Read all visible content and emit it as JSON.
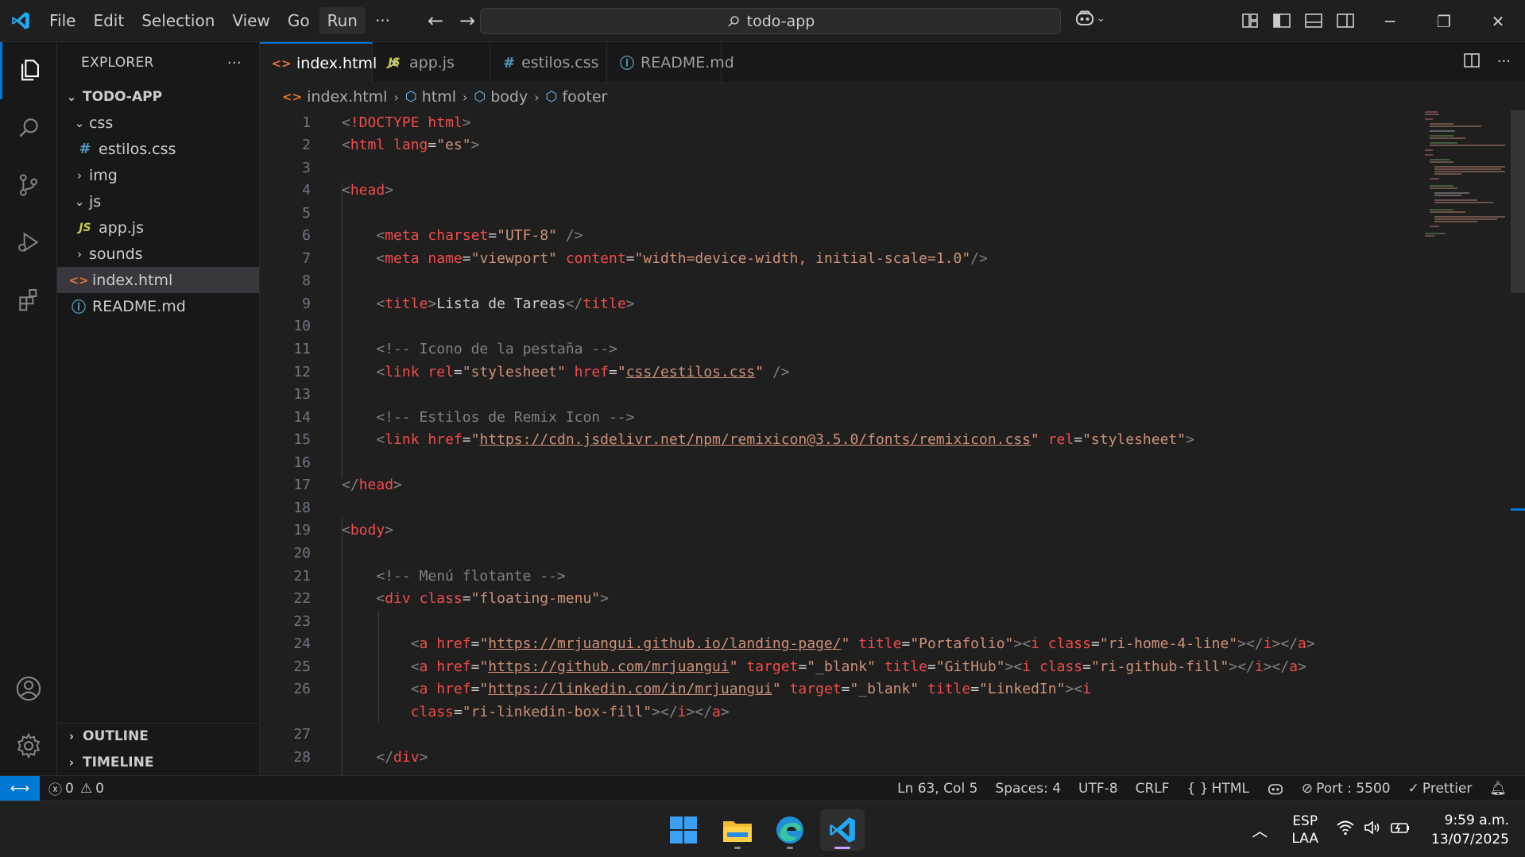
{
  "titlebar": {
    "menu": [
      "File",
      "Edit",
      "Selection",
      "View",
      "Go",
      "Run"
    ],
    "more": "···",
    "search_text": "todo-app"
  },
  "explorer": {
    "title": "EXPLORER",
    "more": "···",
    "project": "TODO-APP",
    "tree": [
      {
        "label": "css",
        "kind": "folder",
        "expanded": true,
        "depth": 1
      },
      {
        "label": "estilos.css",
        "kind": "css",
        "depth": 2
      },
      {
        "label": "img",
        "kind": "folder",
        "expanded": false,
        "depth": 1
      },
      {
        "label": "js",
        "kind": "folder",
        "expanded": true,
        "depth": 1
      },
      {
        "label": "app.js",
        "kind": "js",
        "depth": 2
      },
      {
        "label": "sounds",
        "kind": "folder",
        "expanded": false,
        "depth": 1
      },
      {
        "label": "index.html",
        "kind": "html",
        "depth": 1,
        "selected": true
      },
      {
        "label": "README.md",
        "kind": "info",
        "depth": 1
      }
    ],
    "outline": "OUTLINE",
    "timeline": "TIMELINE"
  },
  "tabs": [
    {
      "label": "index.html",
      "kind": "html",
      "active": true
    },
    {
      "label": "app.js",
      "kind": "js"
    },
    {
      "label": "estilos.css",
      "kind": "css"
    },
    {
      "label": "README.md",
      "kind": "info"
    }
  ],
  "breadcrumb": [
    "index.html",
    "html",
    "body",
    "footer"
  ],
  "code_lines": [
    {
      "n": "1",
      "html": "<span class='punc'>&lt;</span><span class='tag'>!DOCTYPE</span> <span class='attr'>html</span><span class='punc'>&gt;</span>"
    },
    {
      "n": "2",
      "html": "<span class='punc'>&lt;</span><span class='tag'>html</span> <span class='attr'>lang</span><span class='txt'>=</span><span class='str'>\"es\"</span><span class='punc'>&gt;</span>"
    },
    {
      "n": "3",
      "html": ""
    },
    {
      "n": "4",
      "html": "<span class='punc'>&lt;</span><span class='tag'>head</span><span class='punc'>&gt;</span>"
    },
    {
      "n": "5",
      "html": ""
    },
    {
      "n": "6",
      "html": "    <span class='punc'>&lt;</span><span class='tag'>meta</span> <span class='attr'>charset</span><span class='txt'>=</span><span class='str'>\"UTF-8\"</span> <span class='punc'>/&gt;</span>"
    },
    {
      "n": "7",
      "html": "    <span class='punc'>&lt;</span><span class='tag'>meta</span> <span class='attr'>name</span><span class='txt'>=</span><span class='str'>\"viewport\"</span> <span class='attr'>content</span><span class='txt'>=</span><span class='str'>\"width=device-width, initial-scale=1.0\"</span><span class='punc'>/&gt;</span>"
    },
    {
      "n": "8",
      "html": ""
    },
    {
      "n": "9",
      "html": "    <span class='punc'>&lt;</span><span class='tag'>title</span><span class='punc'>&gt;</span><span class='txt'>Lista de Tareas</span><span class='punc'>&lt;/</span><span class='tag'>title</span><span class='punc'>&gt;</span>"
    },
    {
      "n": "10",
      "html": ""
    },
    {
      "n": "11",
      "html": "    <span class='punc'>&lt;!-- Icono de la pestaña --&gt;</span>"
    },
    {
      "n": "12",
      "html": "    <span class='punc'>&lt;</span><span class='tag'>link</span> <span class='attr'>rel</span><span class='txt'>=</span><span class='str'>\"stylesheet\"</span> <span class='attr'>href</span><span class='txt'>=</span><span class='str'>\"<span class='link'>css/estilos.css</span>\"</span> <span class='punc'>/&gt;</span>"
    },
    {
      "n": "13",
      "html": ""
    },
    {
      "n": "14",
      "html": "    <span class='punc'>&lt;!-- Estilos de Remix Icon --&gt;</span>"
    },
    {
      "n": "15",
      "html": "    <span class='punc'>&lt;</span><span class='tag'>link</span> <span class='attr'>href</span><span class='txt'>=</span><span class='str'>\"<span class='link'>https://cdn.jsdelivr.net/npm/remixicon@3.5.0/fonts/remixicon.css</span>\"</span> <span class='attr'>rel</span><span class='txt'>=</span><span class='str'>\"stylesheet\"</span><span class='punc'>&gt;</span>"
    },
    {
      "n": "16",
      "html": ""
    },
    {
      "n": "17",
      "html": "<span class='punc'>&lt;/</span><span class='tag'>head</span><span class='punc'>&gt;</span>"
    },
    {
      "n": "18",
      "html": ""
    },
    {
      "n": "19",
      "html": "<span class='punc'>&lt;</span><span class='tag'>body</span><span class='punc'>&gt;</span>"
    },
    {
      "n": "20",
      "html": ""
    },
    {
      "n": "21",
      "html": "    <span class='punc'>&lt;!-- Menú flotante --&gt;</span>"
    },
    {
      "n": "22",
      "html": "    <span class='punc'>&lt;</span><span class='tag'>div</span> <span class='attr'>class</span><span class='txt'>=</span><span class='str'>\"floating-menu\"</span><span class='punc'>&gt;</span>"
    },
    {
      "n": "23",
      "html": ""
    },
    {
      "n": "24",
      "html": "        <span class='punc'>&lt;</span><span class='tag'>a</span> <span class='attr'>href</span><span class='txt'>=</span><span class='str'>\"<span class='link'>https://mrjuangui.github.io/landing-page/</span>\"</span> <span class='attr'>title</span><span class='txt'>=</span><span class='str'>\"Portafolio\"</span><span class='punc'>&gt;&lt;</span><span class='tag'>i</span> <span class='attr'>class</span><span class='txt'>=</span><span class='str'>\"ri-home-4-line\"</span><span class='punc'>&gt;&lt;/</span><span class='tag'>i</span><span class='punc'>&gt;&lt;/</span><span class='tag'>a</span><span class='punc'>&gt;</span>"
    },
    {
      "n": "25",
      "html": "        <span class='punc'>&lt;</span><span class='tag'>a</span> <span class='attr'>href</span><span class='txt'>=</span><span class='str'>\"<span class='link'>https://github.com/mrjuangui</span>\"</span> <span class='attr'>target</span><span class='txt'>=</span><span class='str'>\"_blank\"</span> <span class='attr'>title</span><span class='txt'>=</span><span class='str'>\"GitHub\"</span><span class='punc'>&gt;&lt;</span><span class='tag'>i</span> <span class='attr'>class</span><span class='txt'>=</span><span class='str'>\"ri-github-fill\"</span><span class='punc'>&gt;&lt;/</span><span class='tag'>i</span><span class='punc'>&gt;&lt;/</span><span class='tag'>a</span><span class='punc'>&gt;</span>"
    },
    {
      "n": "26",
      "html": "        <span class='punc'>&lt;</span><span class='tag'>a</span> <span class='attr'>href</span><span class='txt'>=</span><span class='str'>\"<span class='link'>https://linkedin.com/in/mrjuangui</span>\"</span> <span class='attr'>target</span><span class='txt'>=</span><span class='str'>\"_blank\"</span> <span class='attr'>title</span><span class='txt'>=</span><span class='str'>\"LinkedIn\"</span><span class='punc'>&gt;&lt;</span><span class='tag'>i</span>"
    },
    {
      "n": "",
      "html": "        <span class='attr'>class</span><span class='txt'>=</span><span class='str'>\"ri-linkedin-box-fill\"</span><span class='punc'>&gt;&lt;/</span><span class='tag'>i</span><span class='punc'>&gt;&lt;/</span><span class='tag'>a</span><span class='punc'>&gt;</span>"
    },
    {
      "n": "27",
      "html": ""
    },
    {
      "n": "28",
      "html": "    <span class='punc'>&lt;/</span><span class='tag'>div</span><span class='punc'>&gt;</span>"
    }
  ],
  "statusbar": {
    "errors": "0",
    "warnings": "0",
    "position": "Ln 63, Col 5",
    "spaces": "Spaces: 4",
    "encoding": "UTF-8",
    "eol": "CRLF",
    "language": "HTML",
    "port": "Port : 5500",
    "formatter": "Prettier"
  },
  "taskbar": {
    "lang_top": "ESP",
    "lang_bottom": "LAA",
    "time": "9:59 a.m.",
    "date": "13/07/2025"
  },
  "colors": {
    "accent": "#0078d4",
    "tag": "#f14c4c",
    "string": "#ce9178"
  }
}
